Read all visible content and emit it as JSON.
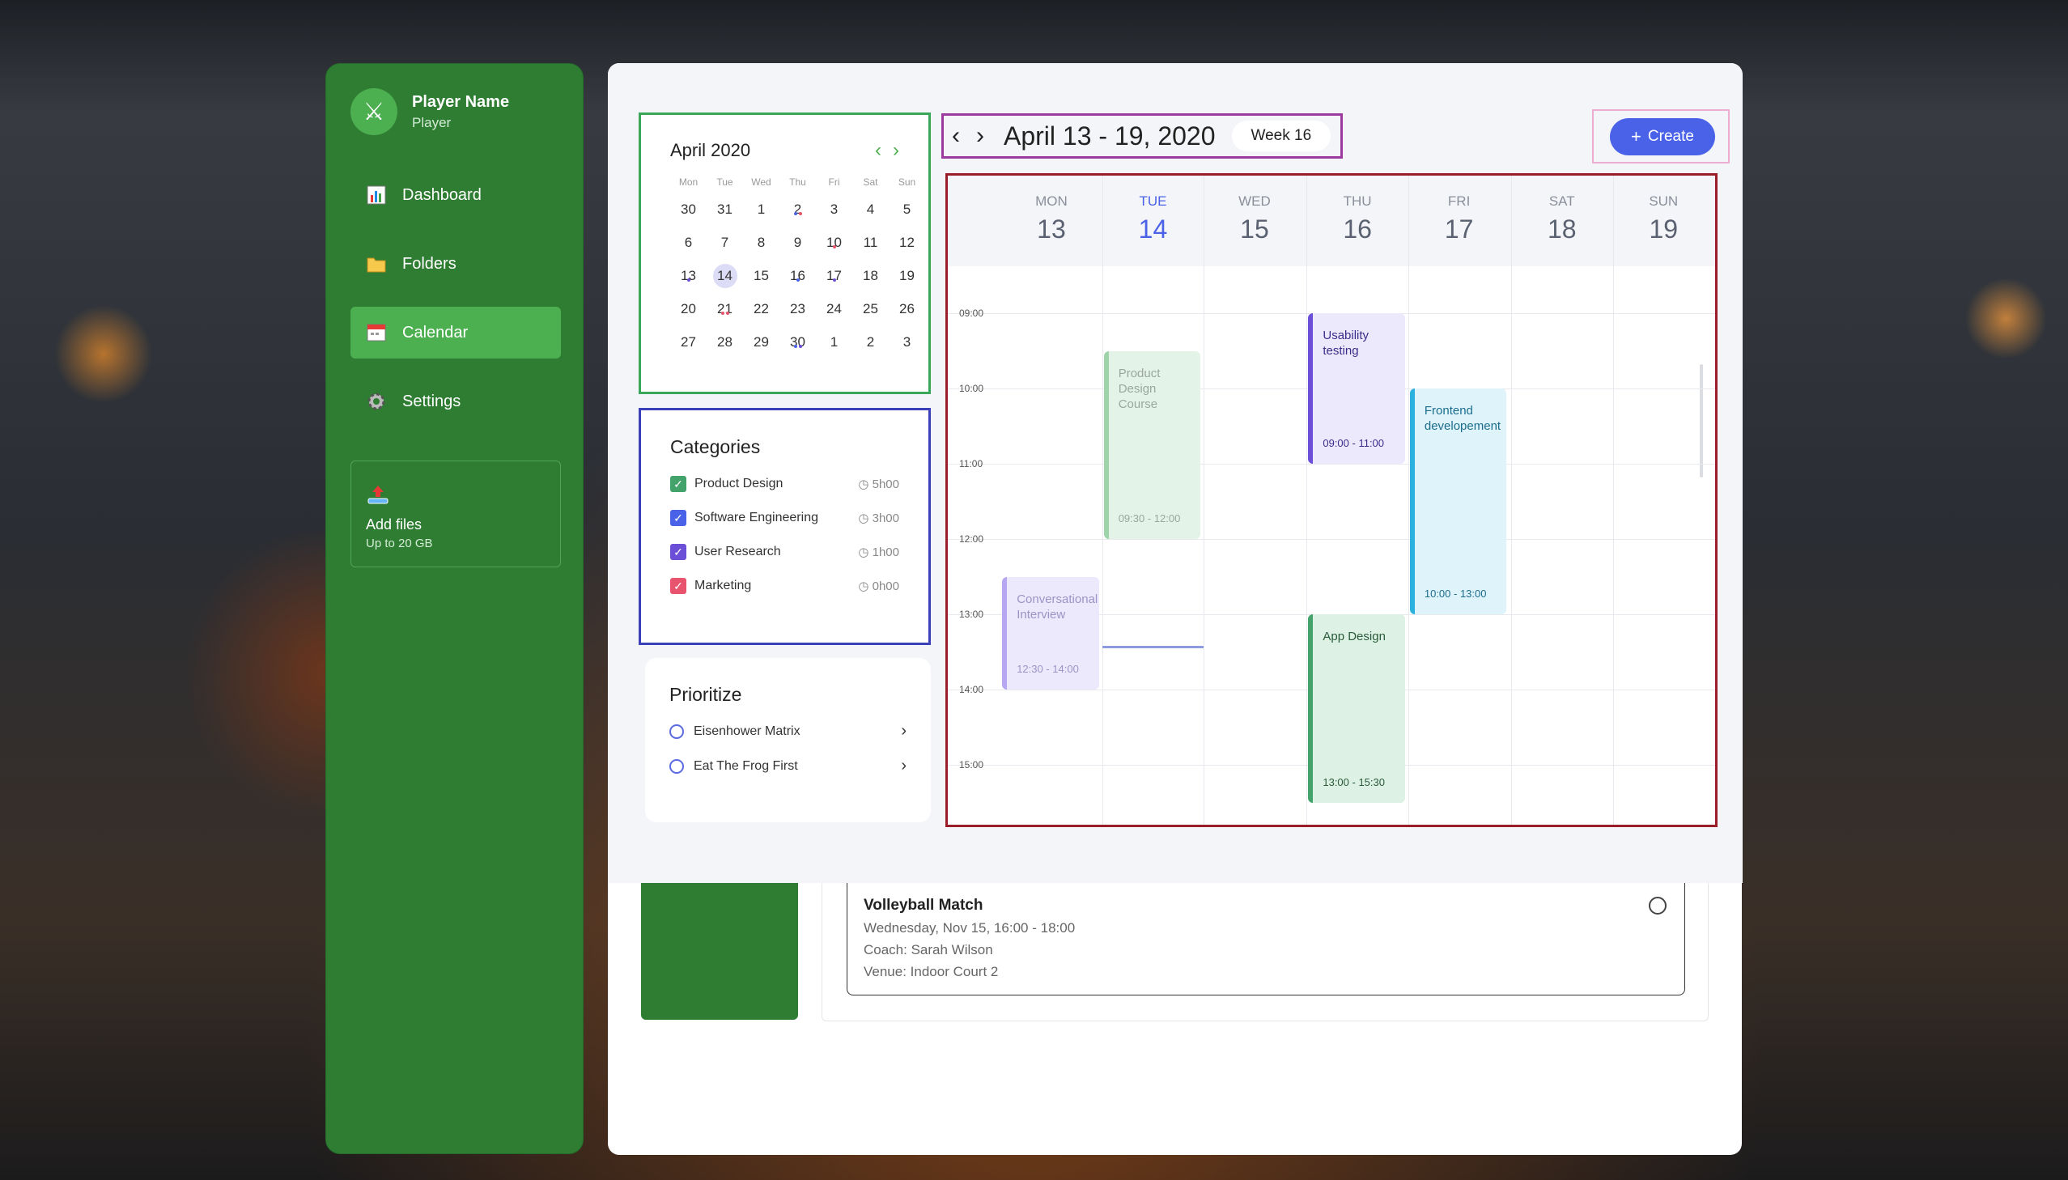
{
  "profile": {
    "name": "Player Name",
    "role": "Player"
  },
  "nav": [
    {
      "label": "Dashboard",
      "icon": "bar-chart-icon"
    },
    {
      "label": "Folders",
      "icon": "folder-icon"
    },
    {
      "label": "Calendar",
      "icon": "calendar-icon",
      "active": true
    },
    {
      "label": "Settings",
      "icon": "gear-icon"
    }
  ],
  "add_files": {
    "title": "Add files",
    "subtitle": "Up to 20 GB"
  },
  "minical": {
    "title": "April 2020",
    "dow": [
      "Mon",
      "Tue",
      "Wed",
      "Thu",
      "Fri",
      "Sat",
      "Sun"
    ],
    "weeks": [
      [
        "30",
        "31",
        "1",
        "2",
        "3",
        "4",
        "5"
      ],
      [
        "6",
        "7",
        "8",
        "9",
        "10",
        "11",
        "12"
      ],
      [
        "13",
        "14",
        "15",
        "16",
        "17",
        "18",
        "19"
      ],
      [
        "20",
        "21",
        "22",
        "23",
        "24",
        "25",
        "26"
      ],
      [
        "27",
        "28",
        "29",
        "30",
        "1",
        "2",
        "3"
      ]
    ],
    "selected": "14"
  },
  "categories": {
    "title": "Categories",
    "items": [
      {
        "label": "Product Design",
        "time": "5h00",
        "color": "#43a36b"
      },
      {
        "label": "Software Engineering",
        "time": "3h00",
        "color": "#4a62e8"
      },
      {
        "label": "User Research",
        "time": "1h00",
        "color": "#6b4fd6"
      },
      {
        "label": "Marketing",
        "time": "0h00",
        "color": "#e8536e"
      }
    ]
  },
  "prioritize": {
    "title": "Prioritize",
    "items": [
      {
        "label": "Eisenhower Matrix"
      },
      {
        "label": "Eat The Frog First"
      }
    ]
  },
  "header": {
    "range": "April 13 - 19, 2020",
    "week": "Week 16",
    "create": "Create"
  },
  "week": {
    "days": [
      {
        "name": "MON",
        "date": "13"
      },
      {
        "name": "TUE",
        "date": "14",
        "today": true
      },
      {
        "name": "WED",
        "date": "15"
      },
      {
        "name": "THU",
        "date": "16"
      },
      {
        "name": "FRI",
        "date": "17"
      },
      {
        "name": "SAT",
        "date": "18"
      },
      {
        "name": "SUN",
        "date": "19"
      }
    ],
    "hours": [
      "09:00",
      "10:00",
      "11:00",
      "12:00",
      "13:00",
      "14:00",
      "15:00"
    ],
    "events": [
      {
        "title": "Product Design Course",
        "time": "09:30 - 12:00",
        "day": 1
      },
      {
        "title": "Usability testing",
        "time": "09:00 - 11:00",
        "day": 3
      },
      {
        "title": "Frontend developement",
        "time": "10:00 - 13:00",
        "day": 4
      },
      {
        "title": "Conversational Interview",
        "time": "12:30 - 14:00",
        "day": 0
      },
      {
        "title": "App Design",
        "time": "13:00 - 15:30",
        "day": 3
      }
    ]
  },
  "event_card": {
    "title": "Volleyball Match",
    "date": "Wednesday, Nov 15, 16:00 - 18:00",
    "coach": "Coach: Sarah Wilson",
    "venue": "Venue: Indoor Court 2"
  }
}
